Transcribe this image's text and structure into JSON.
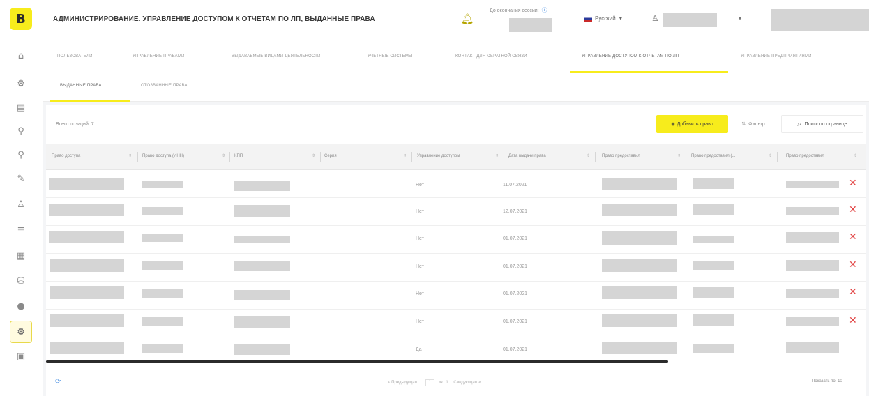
{
  "brand": {
    "logo_letter": "B",
    "accent": "#f7ec1c",
    "danger": "#e24646",
    "link": "#4a90e2"
  },
  "rail": {
    "icons": [
      "home-icon",
      "dashboard-icon",
      "documents-icon",
      "settings-icon",
      "tools-icon",
      "wrench-icon",
      "person-icon",
      "list-icon",
      "grid-icon",
      "database-icon",
      "globe-icon",
      "admin-gear-icon",
      "report-icon"
    ],
    "active_index": 11
  },
  "header": {
    "title": "АДМИНИСТРИРОВАНИЕ. УПРАВЛЕНИЕ ДОСТУПОМ К ОТЧЕТАМ ПО ЛП, ВЫДАННЫЕ ПРАВА",
    "session_label": "До окончания сессии:",
    "session_info_glyph": "ⓘ",
    "language": "Русский",
    "language_chevron": "▾",
    "user_chevron": "▾"
  },
  "tabs_top": [
    "ПОЛЬЗОВАТЕЛИ",
    "УПРАВЛЕНИЕ ПРАВАМИ",
    "ВЫДАВАЕМЫЕ ВИДАМИ ДЕЯТЕЛЬНОСТИ",
    "УЧЕТНЫЕ СИСТЕМЫ",
    "КОНТАКТ ДЛЯ ОБРАТНОЙ СВЯЗИ",
    "УПРАВЛЕНИЕ ДОСТУПОМ К ОТЧЕТАМ ПО ЛП",
    "УПРАВЛЕНИЕ ПРЕДПРИЯТИЯМИ"
  ],
  "tabs_top_active": 5,
  "tabs_sub": [
    "ВЫДАННЫЕ ПРАВА",
    "ОТОЗВАННЫЕ ПРАВА"
  ],
  "tabs_sub_active": 0,
  "toolbar": {
    "total_label": "Всего позиций: 7",
    "add_plus": "+",
    "add_label": "Добавить право",
    "filter_glyph": "⇅",
    "filter_label": "Фильтр",
    "search_glyph": "⌕",
    "search_label": "Поиск по странице"
  },
  "table": {
    "columns": [
      "Право доступа",
      "Право доступа (ИНН)",
      "КПП",
      "Серия",
      "Управление доступом",
      "Дата выдачи права",
      "Право предоставил",
      "Право предоставил (...",
      "Право предоставил"
    ],
    "sort_glyph": "⇕",
    "rows": [
      {
        "access_mgmt": "Нет",
        "issue_date": "11.07.2021",
        "deletable": true
      },
      {
        "access_mgmt": "Нет",
        "issue_date": "12.07.2021",
        "deletable": true
      },
      {
        "access_mgmt": "Нет",
        "issue_date": "01.07.2021",
        "deletable": true
      },
      {
        "access_mgmt": "Нет",
        "issue_date": "01.07.2021",
        "deletable": true
      },
      {
        "access_mgmt": "Нет",
        "issue_date": "01.07.2021",
        "deletable": true
      },
      {
        "access_mgmt": "Нет",
        "issue_date": "01.07.2021",
        "deletable": true
      },
      {
        "access_mgmt": "Да",
        "issue_date": "01.07.2021",
        "deletable": false
      }
    ],
    "delete_glyph": "✕"
  },
  "footer": {
    "refresh_glyph": "⟳",
    "prev_label": "< Предыдущая",
    "page_current": "1",
    "page_sep": "из",
    "page_total": "1",
    "next_label": "Следующая >",
    "show_per_label": "Показать по: 10"
  }
}
